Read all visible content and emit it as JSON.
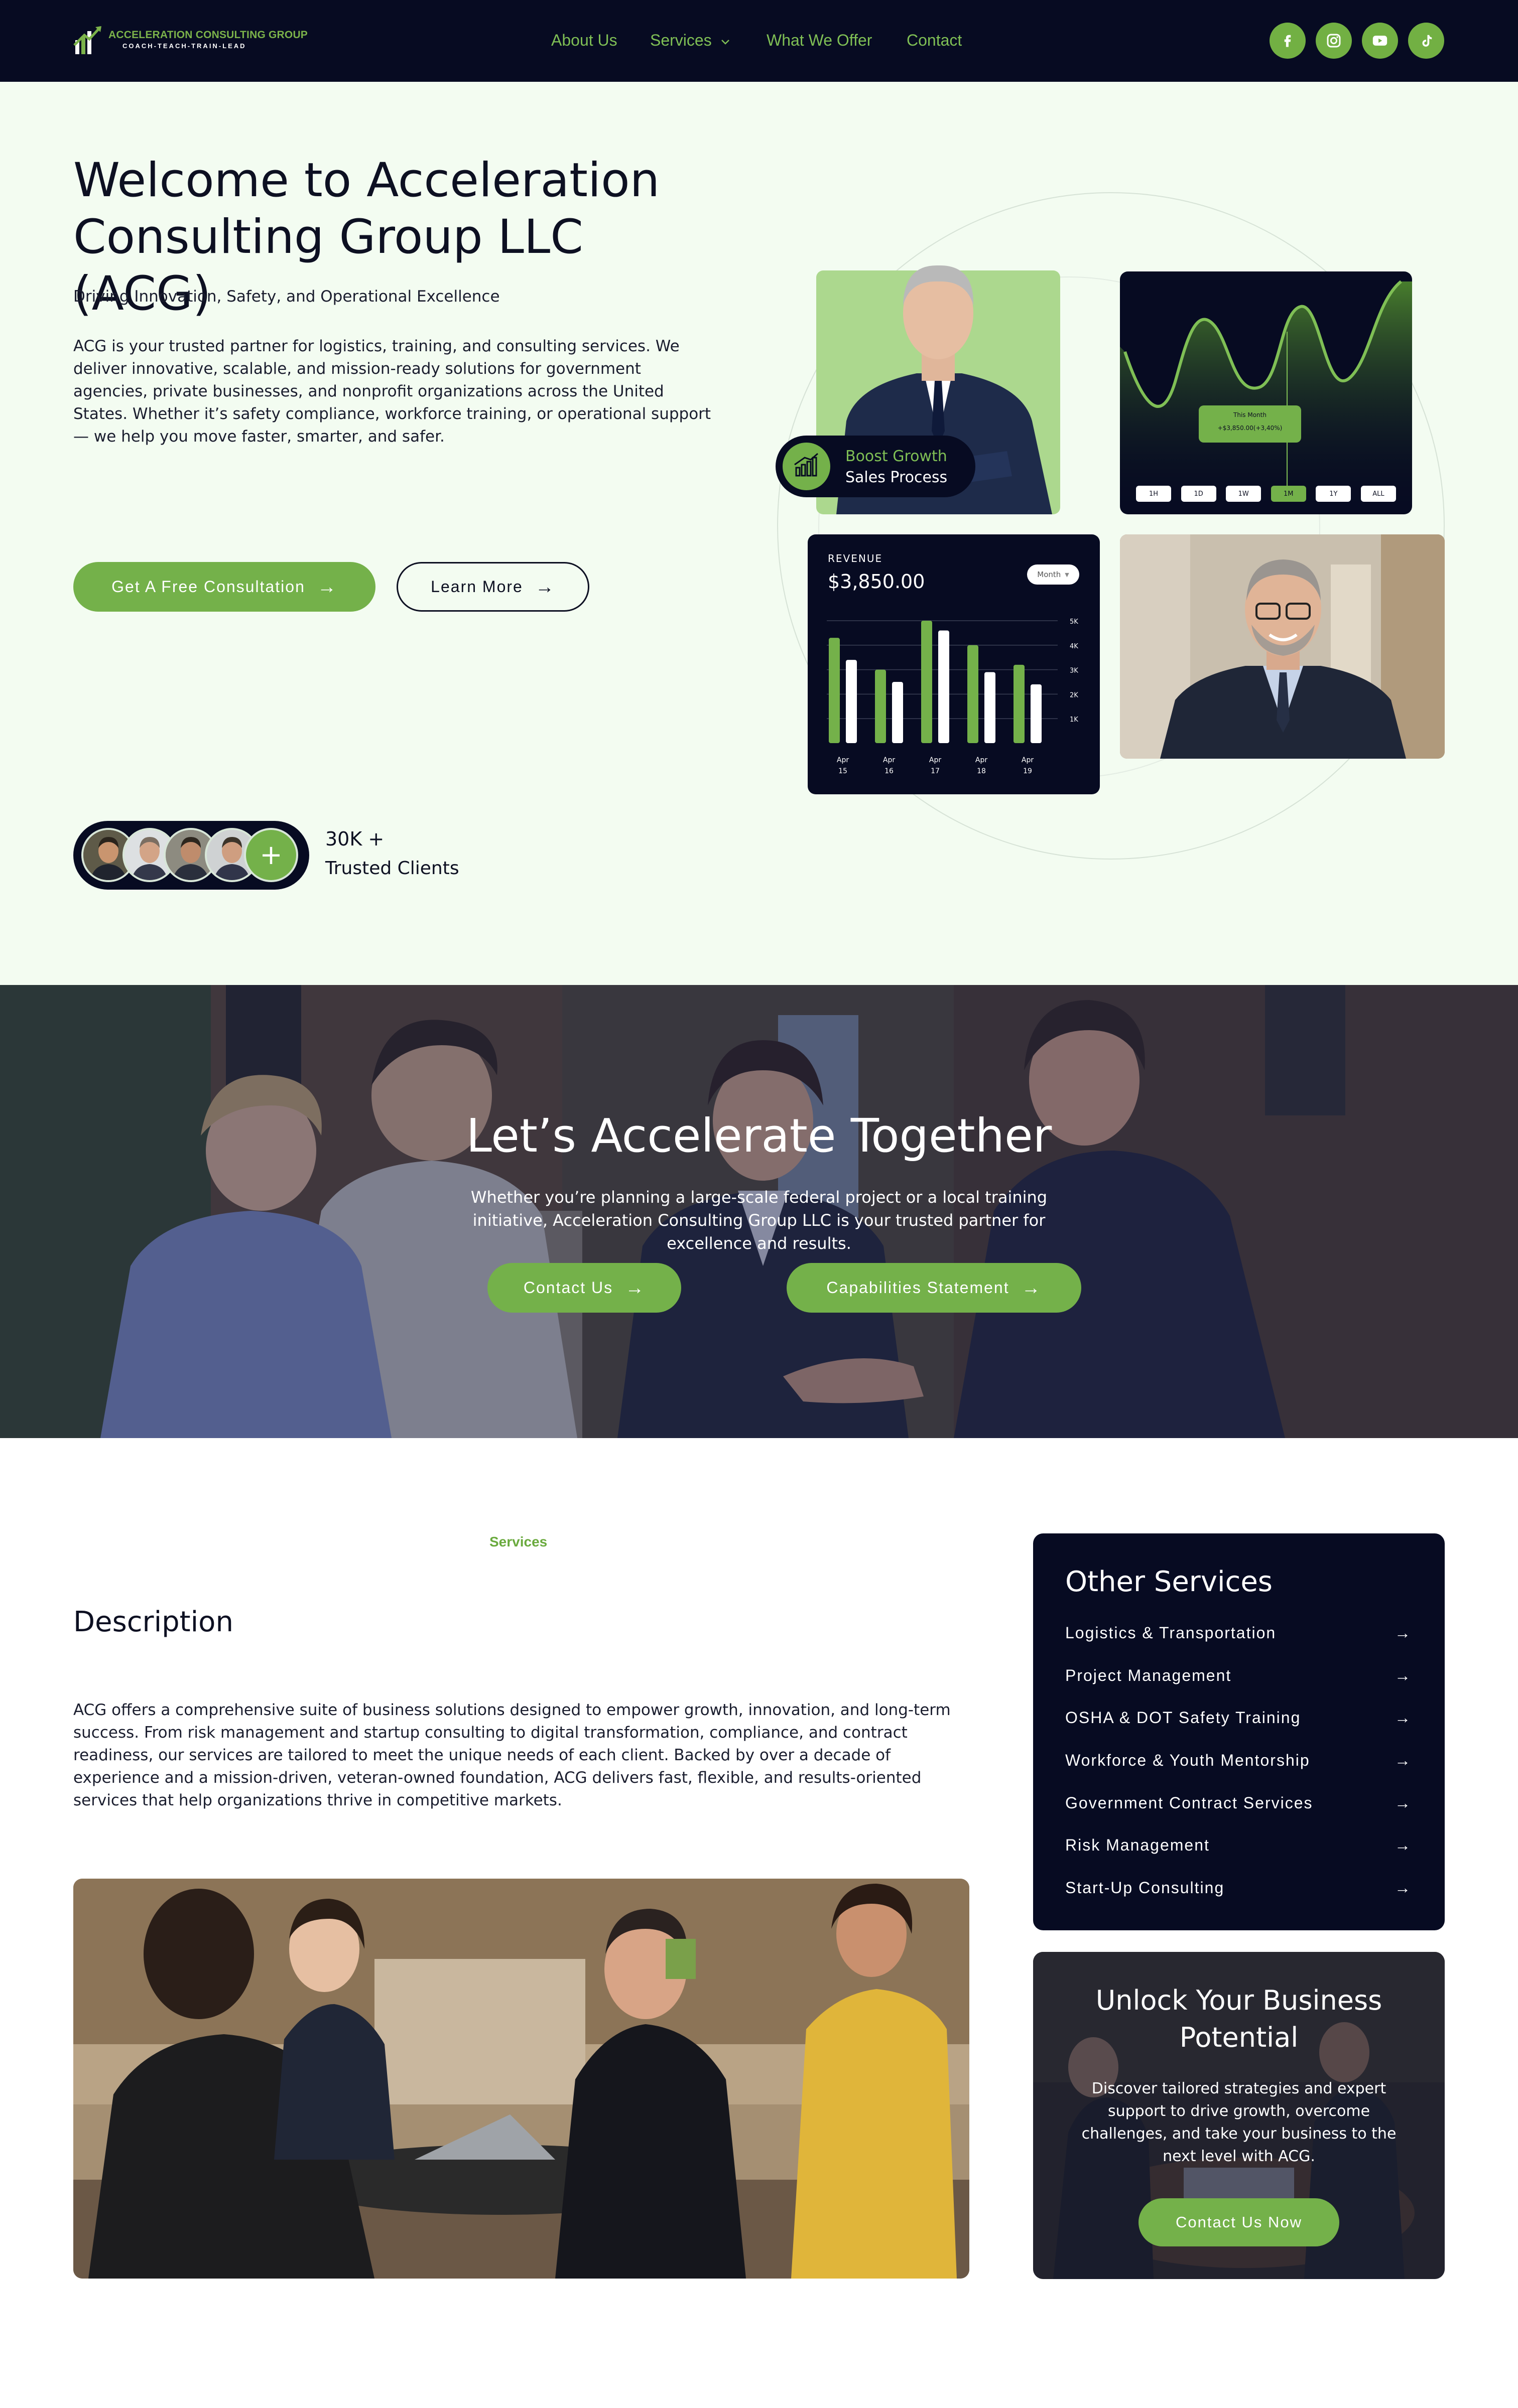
{
  "nav": {
    "logo_line1": "ACCELERATION CONSULTING GROUP",
    "logo_line2": "COACH-TEACH-TRAIN-LEAD",
    "links": [
      "About Us",
      "Services",
      "What We Offer",
      "Contact"
    ],
    "services_chevron": "chevron-down-icon",
    "social": [
      "facebook-icon",
      "instagram-icon",
      "youtube-icon",
      "tiktok-icon"
    ]
  },
  "hero": {
    "title": "Welcome to Acceleration Consulting Group LLC (ACG)",
    "tagline": "Driving Innovation, Safety, and Operational Excellence",
    "intro": "ACG is your trusted partner for logistics, training, and consulting services. We deliver innovative, scalable, and mission-ready solutions for government agencies, private businesses, and nonprofit organizations across the United States. Whether it’s safety compliance, workforce training, or operational support — we help you move faster, smarter, and safer.",
    "cta_primary": "Get A Free Consultation",
    "cta_secondary": "Learn More",
    "badge_line1": "Boost Growth",
    "badge_line2": "Sales Process",
    "clients_count": "30K +",
    "clients_label": "Trusted Clients",
    "clients_plus": "+"
  },
  "line_card": {
    "tooltip_title": "This Month",
    "tooltip_value": "+$3,850.00(+3,40%)",
    "ranges": [
      "1H",
      "1D",
      "1W",
      "1M",
      "1Y",
      "ALL"
    ],
    "active_range": "1M"
  },
  "revenue_card": {
    "label": "REVENUE",
    "amount": "$3,850.00",
    "period": "Month",
    "yticks": [
      "5K",
      "4K",
      "3K",
      "2K",
      "1K"
    ],
    "xlabels": [
      [
        "Apr",
        "15"
      ],
      [
        "Apr",
        "16"
      ],
      [
        "Apr",
        "17"
      ],
      [
        "Apr",
        "18"
      ],
      [
        "Apr",
        "19"
      ]
    ]
  },
  "chart_data": {
    "type": "bar",
    "categories": [
      "Apr 15",
      "Apr 16",
      "Apr 17",
      "Apr 18",
      "Apr 19"
    ],
    "series": [
      {
        "values": [
          4.3,
          3.0,
          5.0,
          4.0,
          3.2
        ]
      },
      {
        "values": [
          3.4,
          2.5,
          4.6,
          2.9,
          2.4
        ]
      }
    ],
    "ylim": [
      0,
      5
    ],
    "colors": [
      "#74b14a",
      "#ffffff"
    ]
  },
  "banner": {
    "title": "Let’s Accelerate Together",
    "text": "Whether you’re planning a large-scale federal project or a local training initiative, Acceleration Consulting Group LLC is your trusted partner for excellence and results.",
    "btn1": "Contact Us",
    "btn2": "Capabilities Statement"
  },
  "services": {
    "label": "Services",
    "heading": "Description",
    "text": "ACG offers a comprehensive suite of business solutions designed to empower growth, innovation, and long-term success. From risk management and startup consulting to digital transformation, compliance, and contract readiness, our services are tailored to meet the unique needs of each client. Backed by over a decade of experience and a mission-driven, veteran-owned foundation, ACG delivers fast, flexible, and results-oriented services that help organizations thrive in competitive markets."
  },
  "other_services": {
    "title": "Other Services",
    "items": [
      "Logistics & Transportation",
      "Project Management",
      "OSHA & DOT Safety Training",
      "Workforce & Youth Mentorship",
      "Government Contract Services",
      "Risk Management",
      "Start-Up Consulting"
    ]
  },
  "cta_card": {
    "title": "Unlock Your Business Potential",
    "text": "Discover tailored strategies and expert support to drive growth, overcome challenges, and take your business to the next level with ACG.",
    "button": "Contact Us Now"
  },
  "colors": {
    "brand_green": "#74b14a",
    "navy": "#070b22",
    "hero_bg": "#f3fcf1"
  }
}
